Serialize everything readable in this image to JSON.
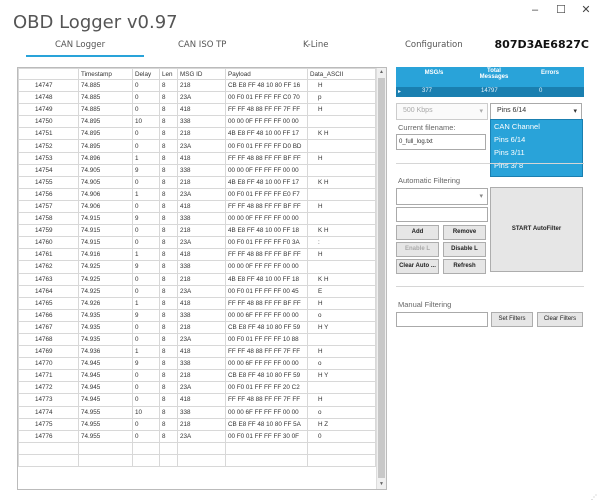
{
  "window": {
    "title": "OBD Logger v0.97",
    "buttons": [
      "–",
      "☐",
      "✕"
    ]
  },
  "tabs": [
    {
      "label": "CAN Logger",
      "active": true
    },
    {
      "label": "CAN ISO TP",
      "active": false
    },
    {
      "label": "K-Line",
      "active": false
    },
    {
      "label": "Configuration",
      "active": false
    }
  ],
  "device_serial": "807D3AE6827C",
  "log_table": {
    "columns": [
      "",
      "Timestamp",
      "Delay",
      "Len",
      "MSG ID",
      "Payload",
      "Data_ASCII"
    ],
    "rows": [
      [
        "14747",
        "74.885",
        "0",
        "8",
        "218",
        "CB E8 FF 48 10 80 FF 16",
        "H"
      ],
      [
        "14748",
        "74.885",
        "0",
        "8",
        "23A",
        "00 F0 01 FF FF FF C0 70",
        "p"
      ],
      [
        "14749",
        "74.885",
        "0",
        "8",
        "418",
        "FF FF 48 88 FF FF 7F FF",
        "H"
      ],
      [
        "14750",
        "74.895",
        "10",
        "8",
        "338",
        "00 00 0F FF FF FF 00 00",
        ""
      ],
      [
        "14751",
        "74.895",
        "0",
        "8",
        "218",
        "4B E8 FF 48 10 00 FF 17",
        "K    H"
      ],
      [
        "14752",
        "74.895",
        "0",
        "8",
        "23A",
        "00 F0 01 FF FF FF D0 BD",
        ""
      ],
      [
        "14753",
        "74.896",
        "1",
        "8",
        "418",
        "FF FF 48 88 FF FF BF FF",
        "H"
      ],
      [
        "14754",
        "74.905",
        "9",
        "8",
        "338",
        "00 00 0F FF FF FF 00 00",
        ""
      ],
      [
        "14755",
        "74.905",
        "0",
        "8",
        "218",
        "4B E8 FF 48 10 00 FF 17",
        "K    H"
      ],
      [
        "14756",
        "74.906",
        "1",
        "8",
        "23A",
        "00 F0 01 FF FF FF E0 F7",
        ""
      ],
      [
        "14757",
        "74.906",
        "0",
        "8",
        "418",
        "FF FF 48 88 FF FF BF FF",
        "H"
      ],
      [
        "14758",
        "74.915",
        "9",
        "8",
        "338",
        "00 00 0F FF FF FF 00 00",
        ""
      ],
      [
        "14759",
        "74.915",
        "0",
        "8",
        "218",
        "4B E8 FF 48 10 00 FF 18",
        "K    H"
      ],
      [
        "14760",
        "74.915",
        "0",
        "8",
        "23A",
        "00 F0 01 FF FF FF F0 3A",
        ":"
      ],
      [
        "14761",
        "74.916",
        "1",
        "8",
        "418",
        "FF FF 48 88 FF FF BF FF",
        "H"
      ],
      [
        "14762",
        "74.925",
        "9",
        "8",
        "338",
        "00 00 0F FF FF FF 00 00",
        ""
      ],
      [
        "14763",
        "74.925",
        "0",
        "8",
        "218",
        "4B E8 FF 48 10 00 FF 18",
        "K    H"
      ],
      [
        "14764",
        "74.925",
        "0",
        "8",
        "23A",
        "00 F0 01 FF FF FF 00 45",
        "E"
      ],
      [
        "14765",
        "74.926",
        "1",
        "8",
        "418",
        "FF FF 48 88 FF FF BF FF",
        "H"
      ],
      [
        "14766",
        "74.935",
        "9",
        "8",
        "338",
        "00 00 6F FF FF FF 00 00",
        "o"
      ],
      [
        "14767",
        "74.935",
        "0",
        "8",
        "218",
        "CB E8 FF 48 10 80 FF 59",
        "H       Y"
      ],
      [
        "14768",
        "74.935",
        "0",
        "8",
        "23A",
        "00 F0 01 FF FF FF 10 88",
        ""
      ],
      [
        "14769",
        "74.936",
        "1",
        "8",
        "418",
        "FF FF 48 88 FF FF 7F FF",
        "H"
      ],
      [
        "14770",
        "74.945",
        "9",
        "8",
        "338",
        "00 00 6F FF FF FF 00 00",
        "o"
      ],
      [
        "14771",
        "74.945",
        "0",
        "8",
        "218",
        "CB E8 FF 48 10 80 FF 59",
        "H       Y"
      ],
      [
        "14772",
        "74.945",
        "0",
        "8",
        "23A",
        "00 F0 01 FF FF FF 20 C2",
        ""
      ],
      [
        "14773",
        "74.945",
        "0",
        "8",
        "418",
        "FF FF 48 88 FF FF 7F FF",
        "H"
      ],
      [
        "14774",
        "74.955",
        "10",
        "8",
        "338",
        "00 00 6F FF FF FF 00 00",
        "o"
      ],
      [
        "14775",
        "74.955",
        "0",
        "8",
        "218",
        "CB E8 FF 48 10 80 FF 5A",
        "H       Z"
      ],
      [
        "14776",
        "74.955",
        "0",
        "8",
        "23A",
        "00 F0 01 FF FF FF 30 0F",
        "0"
      ]
    ]
  },
  "stats": {
    "headers": [
      "MSG/s",
      "Total Messages",
      "Errors"
    ],
    "values": [
      "377",
      "14797",
      "0"
    ],
    "row_marker": "▸"
  },
  "baud_select": {
    "value": "500 Kbps",
    "disabled": true
  },
  "pins_select": {
    "value": "Pins 6/14",
    "options": [
      "CAN Channel",
      "Pins 6/14",
      "Pins 3/11",
      "Pins 3/ 8"
    ]
  },
  "filename": {
    "label": "Current filename:",
    "value": "0_full_log.txt"
  },
  "auto_filter": {
    "label": "Automatic Filtering",
    "select_value": "",
    "input_value": "",
    "buttons": {
      "add": "Add",
      "remove": "Remove",
      "enable": "Enable L",
      "disable": "Disable L",
      "clear": "Clear Auto ...",
      "refresh": "Refresh",
      "start": "START AutoFilter"
    }
  },
  "manual_filter": {
    "label": "Manual Filtering",
    "input_value": "",
    "set_label": "Set Filters",
    "clear_label": "Clear Filters"
  },
  "colors": {
    "accent": "#29a3d9",
    "accent_dark": "#1a7fb0"
  }
}
